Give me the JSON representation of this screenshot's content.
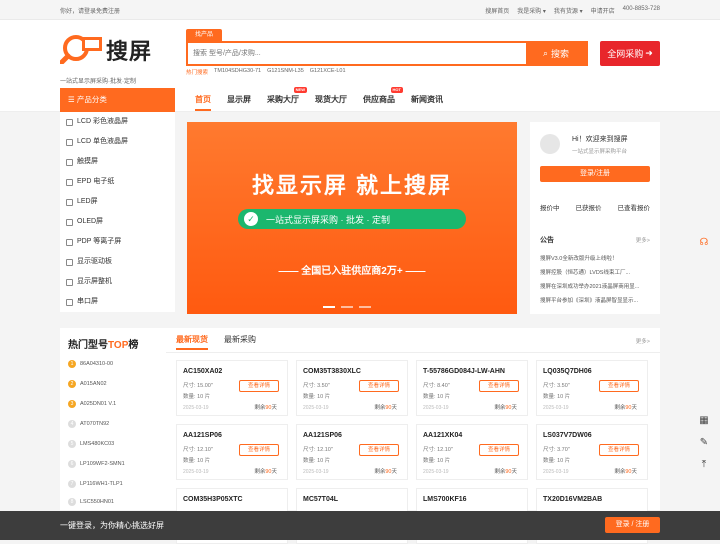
{
  "topbar": {
    "greeting": "你好，请登录免费注册",
    "links": [
      "搜屏首页",
      "我是采购 ▾",
      "我有货源 ▾",
      "申请开店",
      "400-8853-728"
    ]
  },
  "logo": {
    "brand": "搜屏",
    "slogan": "一站式显示屏采购·批发·定制"
  },
  "search": {
    "tab": "找产品",
    "placeholder": "搜索 型号/产品/求购...",
    "button": "搜索",
    "hot_label": "热门搜索",
    "hot_words": [
      "TM104SDHG30-71",
      "G121SNM-L35",
      "G121XCE-L01"
    ],
    "all_purchase": "全网采购"
  },
  "nav": {
    "category": "产品分类",
    "items": [
      {
        "label": "首页",
        "badge": ""
      },
      {
        "label": "显示屏",
        "badge": ""
      },
      {
        "label": "采购大厅",
        "badge": "NEW"
      },
      {
        "label": "现货大厅",
        "badge": ""
      },
      {
        "label": "供应商品",
        "badge": "HOT"
      },
      {
        "label": "新闻资讯",
        "badge": ""
      }
    ]
  },
  "sidebar": {
    "items": [
      "LCD 彩色液晶屏",
      "LCD 单色液晶屏",
      "触摸屏",
      "EPD 电子纸",
      "LED屏",
      "OLED屏",
      "PDP 等离子屏",
      "显示驱动板",
      "显示屏整机",
      "串口屏"
    ]
  },
  "banner": {
    "title": "找显示屏 就上搜屏",
    "pill": "一站式显示屏采购 · 批发 · 定制",
    "sub": "—— 全国已入驻供应商2万+ ——"
  },
  "user": {
    "hi": "Hi！欢迎来到搜屏",
    "hi2": "一站式显示屏采购平台",
    "login": "登录/注册",
    "links": [
      "报价中",
      "已获报价",
      "已查看报价"
    ],
    "notice": "公告",
    "more": "更多>",
    "news": [
      "搜屏V3.0全新改版升级上线啦！",
      "搜屏控股（恒芯通）LVDS线束工厂...",
      "搜屏在深圳成功举办2021液晶屏商用显...",
      "搜屏平台参加《深圳》液晶屏智显显示..."
    ]
  },
  "hot": {
    "title": "热门型号",
    "title_top": "TOP",
    "title_tail": "榜",
    "items": [
      "86A04310-00",
      "A015AN02",
      "A025DN01 V.1",
      "AT070TN92",
      "LMS480KC03",
      "LP109WF2-SMN1",
      "LP116WH1-TLP1",
      "LSC550HN01"
    ]
  },
  "listing": {
    "tabs": [
      "最新现货",
      "最新采购"
    ],
    "more": "更多>",
    "detail_label": "查看详情",
    "size_label": "尺寸",
    "qty_label": "数量",
    "remain_prefix": "剩余",
    "remain_suffix": "天",
    "cards": [
      {
        "model": "AC150XA02",
        "size": "15.00\"",
        "qty": "10 片",
        "date": "2025-03-19",
        "days": "90"
      },
      {
        "model": "COM35T3830XLC",
        "size": "3.50\"",
        "qty": "10 片",
        "date": "2025-03-19",
        "days": "90"
      },
      {
        "model": "T-55786GD084J-LW-AHN",
        "size": "8.40\"",
        "qty": "10 片",
        "date": "2025-03-19",
        "days": "90"
      },
      {
        "model": "LQ035Q7DH06",
        "size": "3.50\"",
        "qty": "10 片",
        "date": "2025-03-19",
        "days": "90"
      },
      {
        "model": "AA121SP06",
        "size": "12.10\"",
        "qty": "10 片",
        "date": "2025-03-19",
        "days": "90"
      },
      {
        "model": "AA121SP06",
        "size": "12.10\"",
        "qty": "10 片",
        "date": "2025-03-19",
        "days": "90"
      },
      {
        "model": "AA121XK04",
        "size": "12.10\"",
        "qty": "10 片",
        "date": "2025-03-19",
        "days": "90"
      },
      {
        "model": "LS037V7DW06",
        "size": "3.70\"",
        "qty": "10 片",
        "date": "2025-03-19",
        "days": "90"
      },
      {
        "model": "COM35H3P05XTC",
        "size": "",
        "qty": "",
        "date": "",
        "days": ""
      },
      {
        "model": "MC57T04L",
        "size": "",
        "qty": "",
        "date": "",
        "days": ""
      },
      {
        "model": "LMS700KF16",
        "size": "",
        "qty": "",
        "date": "",
        "days": ""
      },
      {
        "model": "TX20D16VM2BAB",
        "size": "",
        "qty": "",
        "date": "",
        "days": ""
      }
    ]
  },
  "bottom": {
    "text": "一键登录，为你精心挑选好屏",
    "button": "登录 / 注册"
  },
  "colors": {
    "accent": "#ff6a1f",
    "red": "#e8262b",
    "green": "#1bb76e"
  },
  "icons": [
    "headset-icon",
    "qrcode-icon",
    "edit-icon",
    "back-to-top-icon"
  ]
}
